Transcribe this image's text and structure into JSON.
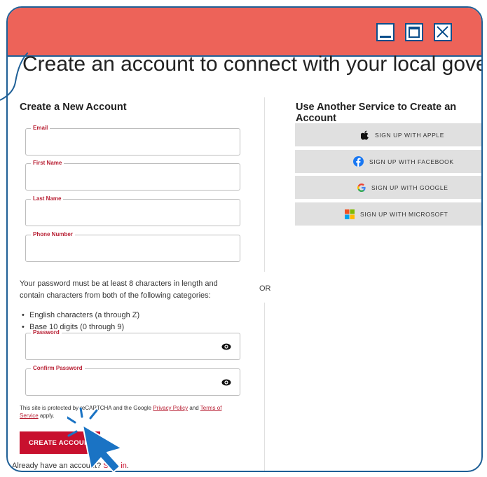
{
  "page": {
    "heading": "Create an account to connect with your local government"
  },
  "left": {
    "title": "Create a New Account",
    "fields": [
      {
        "label": "Email"
      },
      {
        "label": "First Name"
      },
      {
        "label": "Last Name"
      },
      {
        "label": "Phone Number"
      }
    ],
    "password_rules": {
      "intro": "Your password must be at least 8 characters in length and contain characters from both of the following categories:",
      "items": [
        "English characters (a through Z)",
        "Base 10 digits (0 through 9)"
      ]
    },
    "password": {
      "label": "Password",
      "icon": "eye-icon"
    },
    "confirm_password": {
      "label": "Confirm Password",
      "icon": "eye-icon"
    },
    "recaptcha": {
      "prefix": "This site is protected by reCAPTCHA and the Google ",
      "privacy": "Privacy Policy",
      "and": " and ",
      "terms": "Terms of Service",
      "suffix": " apply."
    },
    "create_button": "CREATE ACCOUNT",
    "signin_prefix": "Already have an account? ",
    "signin_link": "Sign in",
    "signin_suffix": "."
  },
  "divider": {
    "or": "OR"
  },
  "right": {
    "title": "Use Another Service to Create an Account",
    "services": [
      {
        "label": "SIGN UP WITH APPLE",
        "icon": "apple-icon"
      },
      {
        "label": "SIGN UP WITH FACEBOOK",
        "icon": "facebook-icon"
      },
      {
        "label": "SIGN UP WITH GOOGLE",
        "icon": "google-icon"
      },
      {
        "label": "SIGN UP WITH MICROSOFT",
        "icon": "microsoft-icon"
      }
    ]
  },
  "colors": {
    "titlebar": "#ed6359",
    "frame": "#1e5f96",
    "accent": "#c8102e",
    "service_button": "#e0e0e0",
    "cursor": "#1a73c4"
  }
}
